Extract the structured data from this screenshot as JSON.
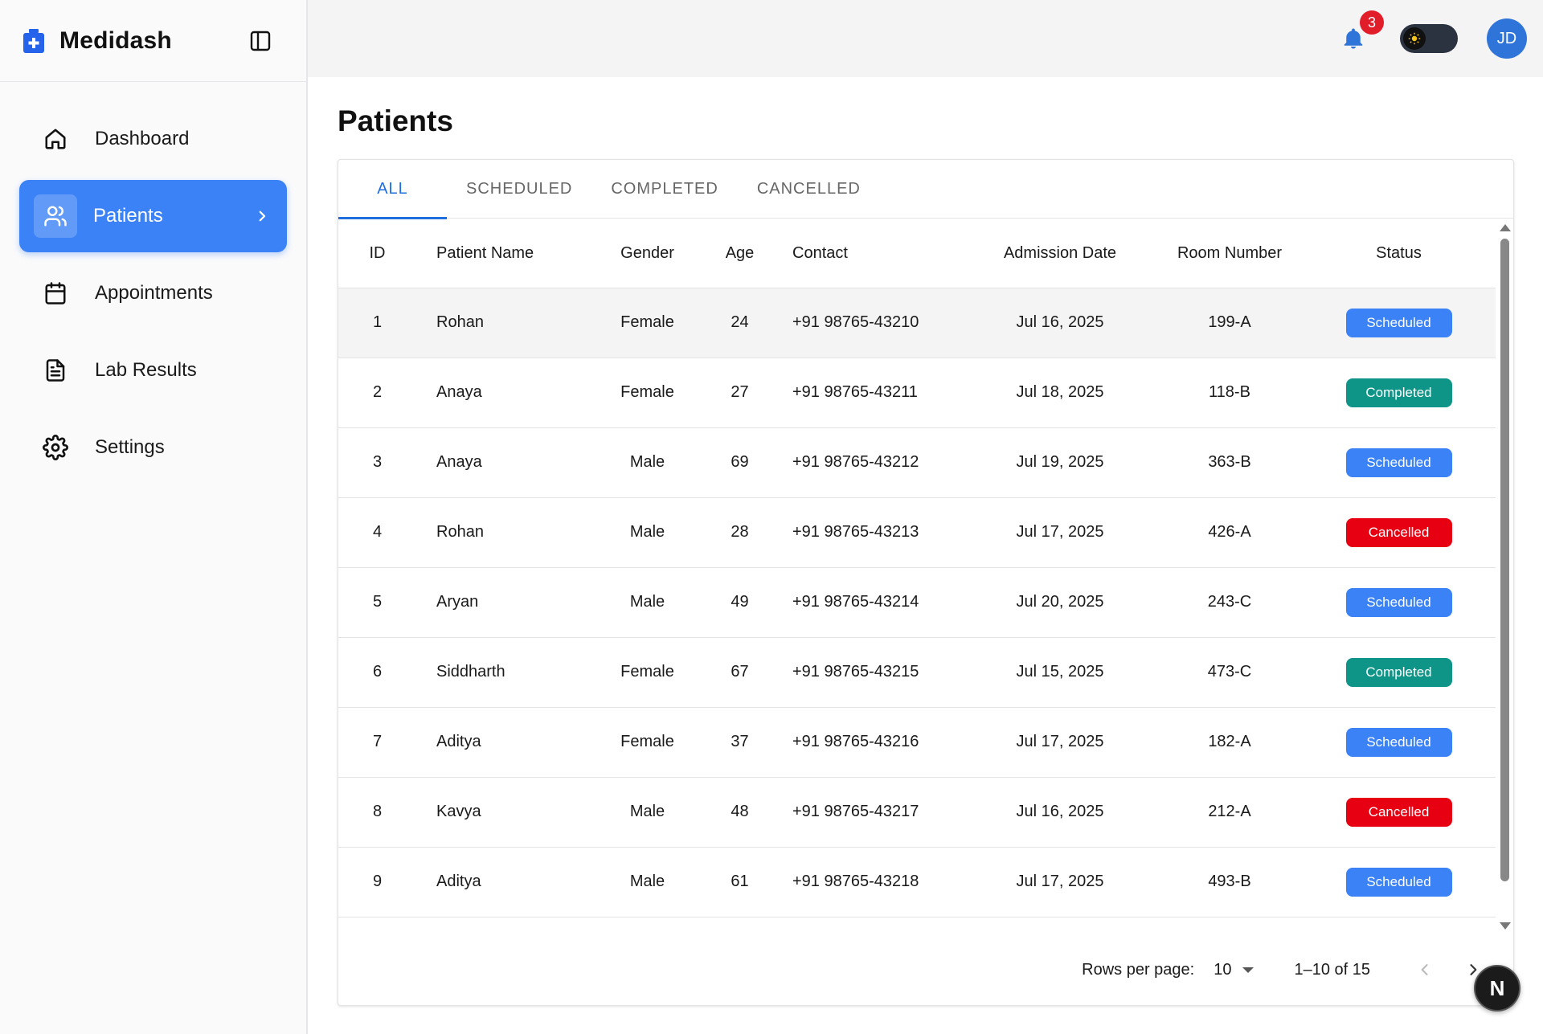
{
  "brand": {
    "name": "Medidash",
    "logo_icon": "medical-case-icon",
    "accent": "#2563eb"
  },
  "sidebar": {
    "items": [
      {
        "label": "Dashboard",
        "icon": "home-icon",
        "active": false
      },
      {
        "label": "Patients",
        "icon": "users-icon",
        "active": true
      },
      {
        "label": "Appointments",
        "icon": "calendar-icon",
        "active": false
      },
      {
        "label": "Lab Results",
        "icon": "file-text-icon",
        "active": false
      },
      {
        "label": "Settings",
        "icon": "gear-icon",
        "active": false
      }
    ]
  },
  "header": {
    "notification_count": "3",
    "avatar_initials": "JD",
    "theme": "dark"
  },
  "page": {
    "title": "Patients"
  },
  "tabs": [
    {
      "label": "ALL",
      "active": true
    },
    {
      "label": "SCHEDULED",
      "active": false
    },
    {
      "label": "COMPLETED",
      "active": false
    },
    {
      "label": "CANCELLED",
      "active": false
    }
  ],
  "table": {
    "columns": [
      "ID",
      "Patient Name",
      "Gender",
      "Age",
      "Contact",
      "Admission Date",
      "Room Number",
      "Status"
    ],
    "rows": [
      {
        "id": "1",
        "name": "Rohan",
        "gender": "Female",
        "age": "24",
        "contact": "+91 98765-43210",
        "date": "Jul 16, 2025",
        "room": "199-A",
        "status": "Scheduled"
      },
      {
        "id": "2",
        "name": "Anaya",
        "gender": "Female",
        "age": "27",
        "contact": "+91 98765-43211",
        "date": "Jul 18, 2025",
        "room": "118-B",
        "status": "Completed"
      },
      {
        "id": "3",
        "name": "Anaya",
        "gender": "Male",
        "age": "69",
        "contact": "+91 98765-43212",
        "date": "Jul 19, 2025",
        "room": "363-B",
        "status": "Scheduled"
      },
      {
        "id": "4",
        "name": "Rohan",
        "gender": "Male",
        "age": "28",
        "contact": "+91 98765-43213",
        "date": "Jul 17, 2025",
        "room": "426-A",
        "status": "Cancelled"
      },
      {
        "id": "5",
        "name": "Aryan",
        "gender": "Male",
        "age": "49",
        "contact": "+91 98765-43214",
        "date": "Jul 20, 2025",
        "room": "243-C",
        "status": "Scheduled"
      },
      {
        "id": "6",
        "name": "Siddharth",
        "gender": "Female",
        "age": "67",
        "contact": "+91 98765-43215",
        "date": "Jul 15, 2025",
        "room": "473-C",
        "status": "Completed"
      },
      {
        "id": "7",
        "name": "Aditya",
        "gender": "Female",
        "age": "37",
        "contact": "+91 98765-43216",
        "date": "Jul 17, 2025",
        "room": "182-A",
        "status": "Scheduled"
      },
      {
        "id": "8",
        "name": "Kavya",
        "gender": "Male",
        "age": "48",
        "contact": "+91 98765-43217",
        "date": "Jul 16, 2025",
        "room": "212-A",
        "status": "Cancelled"
      },
      {
        "id": "9",
        "name": "Aditya",
        "gender": "Male",
        "age": "61",
        "contact": "+91 98765-43218",
        "date": "Jul 17, 2025",
        "room": "493-B",
        "status": "Scheduled"
      }
    ],
    "status_colors": {
      "Scheduled": "#3b82f6",
      "Completed": "#0f9488",
      "Cancelled": "#e60012"
    }
  },
  "pagination": {
    "rows_per_page_label": "Rows per page:",
    "rows_per_page": "10",
    "range": "1–10 of 15"
  },
  "fab": {
    "label": "N"
  }
}
